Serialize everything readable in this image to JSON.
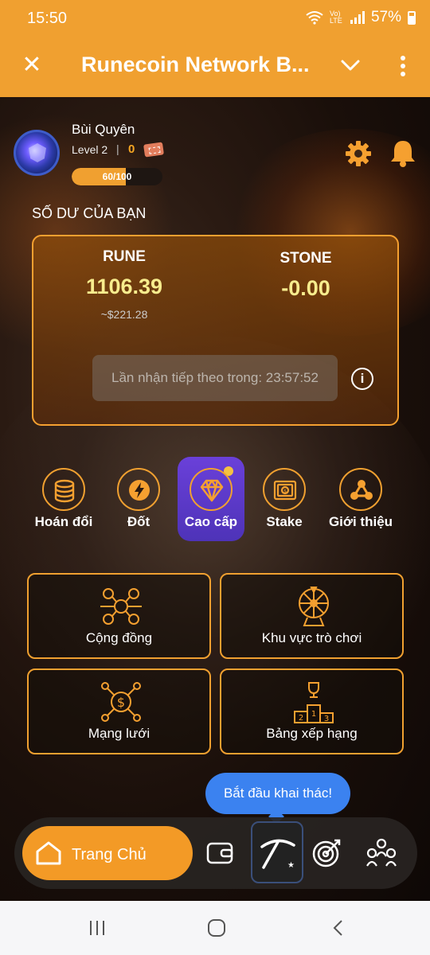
{
  "status_bar": {
    "time": "15:50",
    "network": "Vo) LTE",
    "battery": "57%"
  },
  "app_bar": {
    "title": "Runecoin Network B...",
    "close_icon": "close-icon",
    "menu_icon": "chevron-down-icon",
    "more_icon": "more-vertical-icon"
  },
  "profile": {
    "name": "Bùi Quyên",
    "level": "Level 2",
    "separator": "|",
    "tickets": "0",
    "xp_text": "60/100",
    "xp_fraction": 0.6
  },
  "balance": {
    "heading": "SỐ DƯ CỦA BẠN",
    "rune_label": "RUNE",
    "rune_value": "1106.39",
    "rune_usd": "~$221.28",
    "stone_label": "STONE",
    "stone_value": "-0.00",
    "next_claim": "Lần nhận tiếp theo trong: 23:57:52",
    "info_symbol": "i"
  },
  "actions": [
    {
      "label": "Hoán đổi",
      "icon": "coins-icon"
    },
    {
      "label": "Đốt",
      "icon": "lightning-icon"
    },
    {
      "label": "Cao cấp",
      "icon": "diamond-icon"
    },
    {
      "label": "Stake",
      "icon": "safe-icon"
    },
    {
      "label": "Giới thiệu",
      "icon": "share-icon"
    }
  ],
  "tiles": [
    {
      "label": "Cộng đồng",
      "icon": "community-icon"
    },
    {
      "label": "Khu vực trò chơi",
      "icon": "wheel-icon"
    },
    {
      "label": "Mạng lưới",
      "icon": "network-icon"
    },
    {
      "label": "Bảng xếp hạng",
      "icon": "leaderboard-icon"
    }
  ],
  "tooltip": "Bắt đầu khai thác!",
  "bottom_nav": {
    "home_label": "Trang Chủ"
  },
  "colors": {
    "accent": "#f0a030",
    "premium": "#5a3bc9",
    "tooltip": "#3b82f0",
    "value": "#f7ec8d"
  }
}
